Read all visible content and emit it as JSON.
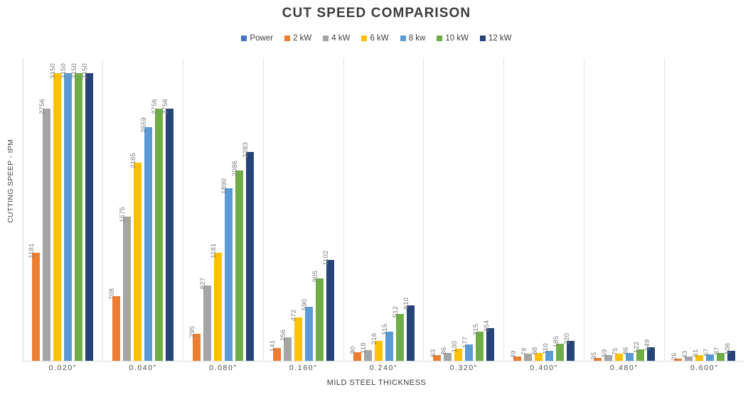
{
  "chart_data": {
    "type": "bar",
    "title": "CUT SPEED COMPARISON",
    "xlabel": "MILD STEEL THICKNESS",
    "ylabel": "CUTTING SPEEP - IPM",
    "categories": [
      "0.020\"",
      "0.040\"",
      "0.080\"",
      "0.160\"",
      "0.240\"",
      "0.320\"",
      "0.400\"",
      "0.480\"",
      "0.600\""
    ],
    "series": [
      {
        "name": "2 kW",
        "color": "#ED7D31",
        "values": [
          1181,
          708,
          295,
          141,
          90,
          63,
          49,
          35,
          26
        ]
      },
      {
        "name": "4 kW",
        "color": "#A5A5A5",
        "values": [
          2756,
          1575,
          827,
          256,
          118,
          86,
          79,
          59,
          43
        ]
      },
      {
        "name": "6 kW",
        "color": "#FFC000",
        "values": [
          3150,
          2165,
          1181,
          472,
          216,
          130,
          88,
          75,
          61
        ]
      },
      {
        "name": "8 kw",
        "color": "#5B9BD5",
        "values": [
          3150,
          2559,
          1890,
          590,
          315,
          177,
          110,
          86,
          67
        ]
      },
      {
        "name": "10 kW",
        "color": "#70AD47",
        "values": [
          3150,
          2756,
          2086,
          905,
          512,
          315,
          185,
          122,
          87
        ]
      },
      {
        "name": "12 kW",
        "color": "#264478",
        "values": [
          3150,
          2756,
          2283,
          1102,
          610,
          354,
          220,
          149,
          106
        ]
      }
    ],
    "legend": [
      {
        "label": "Power",
        "color": "#4472C4"
      },
      {
        "label": "2 kW",
        "color": "#ED7D31"
      },
      {
        "label": "4 kW",
        "color": "#A5A5A5"
      },
      {
        "label": "6 kW",
        "color": "#FFC000"
      },
      {
        "label": "8 kw",
        "color": "#5B9BD5"
      },
      {
        "label": "10 kW",
        "color": "#70AD47"
      },
      {
        "label": "12 kW",
        "color": "#264478"
      }
    ],
    "legend_position": "top",
    "ylim": [
      0,
      3310
    ],
    "grid": false,
    "value_labels": true,
    "value_label_rotation": -90
  }
}
